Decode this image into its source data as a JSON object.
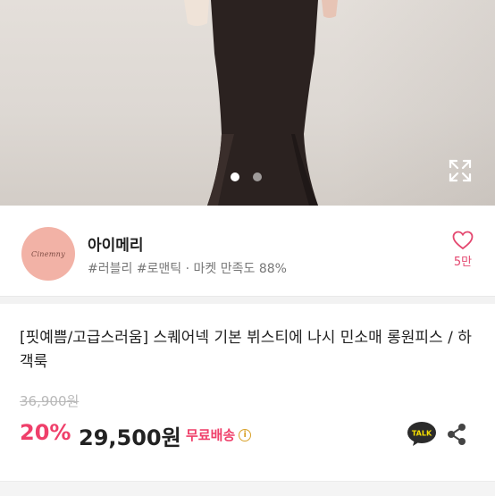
{
  "carousel": {
    "slides": 2,
    "active_index": 0,
    "expand_icon": "expand-icon"
  },
  "seller": {
    "avatar_text": "Cinemny",
    "name": "아이메리",
    "tags": "#러블리 #로맨틱 · 마켓 만족도 88%",
    "like_count": "5만",
    "like_icon": "heart-outline-icon"
  },
  "product": {
    "title": "[핏예쁨/고급스러움] 스퀘어넥 기본 뷔스티에 나시 민소매 롱원피스 / 하객룩",
    "original_price": "36,900원",
    "discount": "20%",
    "price": "29,500원",
    "shipping": "무료배송",
    "info_icon": "info-icon",
    "talk_label": "TALK",
    "share_icon": "share-icon"
  },
  "colors": {
    "accent": "#ef3f6a",
    "talk_yellow": "#f9e000",
    "info": "#d8a12a"
  }
}
